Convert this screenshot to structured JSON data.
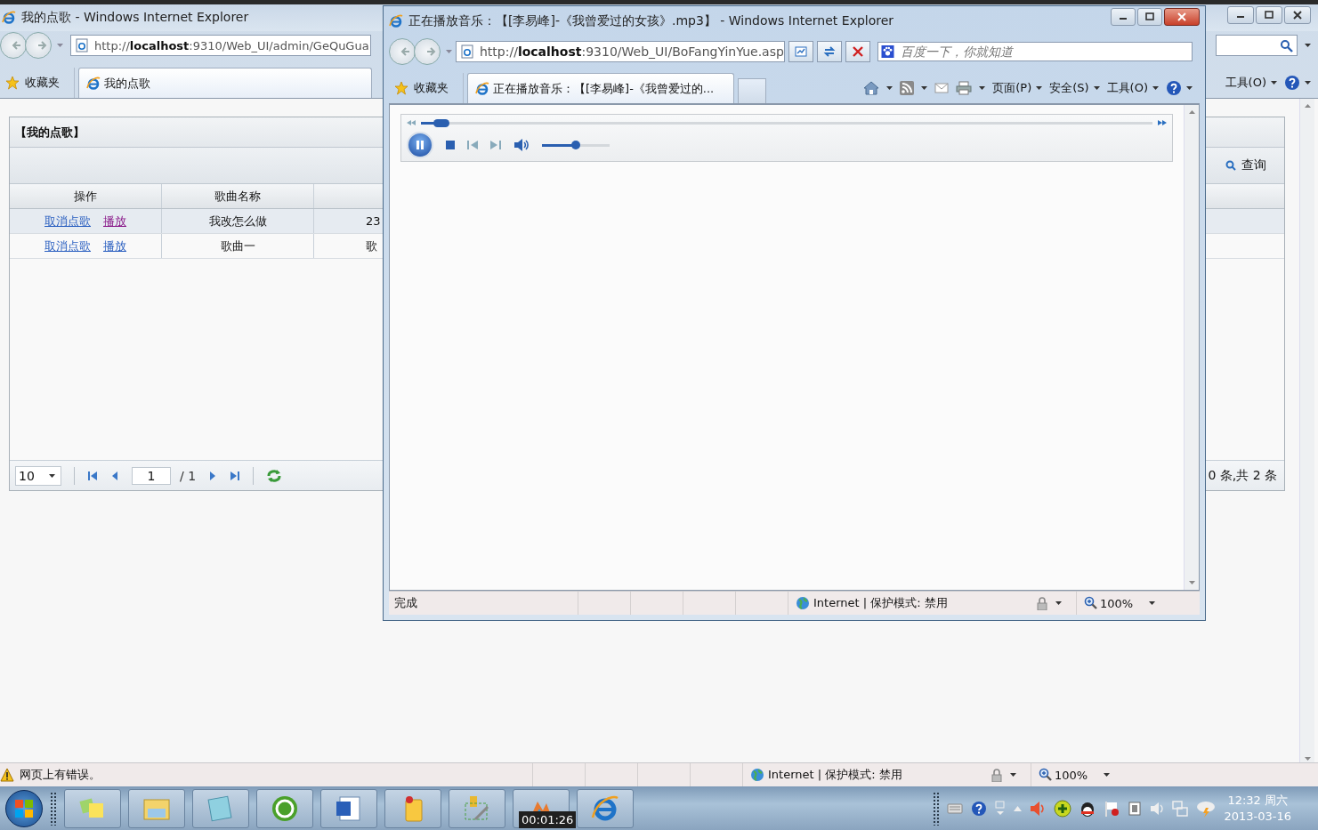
{
  "main_window": {
    "title": "我的点歌 - Windows Internet Explorer",
    "address": "http://localhost:9310/Web_UI/admin/GeQuGua",
    "favorites": "收藏夹",
    "tabs": [
      {
        "label": "我的点歌",
        "selected": true
      }
    ],
    "command_menus": [
      {
        "label": "工具(O)"
      }
    ],
    "panel": {
      "title": "【我的点歌】",
      "search_button": "查询",
      "action_column": "操作",
      "columns": [
        "歌曲名称"
      ],
      "rows": [
        {
          "links": [
            {
              "label": "取消点歌",
              "visited": false
            },
            {
              "label": "播放",
              "visited": true
            }
          ],
          "cells": [
            "我改怎么做",
            "23"
          ]
        },
        {
          "links": [
            {
              "label": "取消点歌",
              "visited": false
            },
            {
              "label": "播放",
              "visited": false
            }
          ],
          "cells": [
            "歌曲一",
            "歌"
          ]
        }
      ],
      "pager": {
        "page_size": "10",
        "page": "1",
        "total_pages": "/ 1",
        "summary": "0 条,共 2 条"
      }
    },
    "status_bar": {
      "message": "网页上有错误。",
      "zone": "Internet | 保护模式: 禁用",
      "zoom": "100%"
    }
  },
  "popup_window": {
    "title": "正在播放音乐：【[李易峰]-《我曾爱过的女孩》.mp3】 - Windows Internet Explorer",
    "address": "http://localhost:9310/Web_UI/BoFangYinYue.asp",
    "search": {
      "placeholder": "百度一下，你就知道"
    },
    "favorites": "收藏夹",
    "tabs": [
      {
        "label": "正在播放音乐：【[李易峰]-《我曾爱过的...",
        "selected": true
      }
    ],
    "command_menus": [
      {
        "label": "页面(P)"
      },
      {
        "label": "安全(S)"
      },
      {
        "label": "工具(O)"
      }
    ],
    "player": {
      "playing": true,
      "position": {
        "level": 0.02
      },
      "volume": {
        "level": 0.5
      }
    },
    "status_bar": {
      "message": "完成",
      "zone": "Internet | 保护模式: 禁用",
      "zoom": "100%"
    }
  },
  "taskbar": {
    "tooltip": "00:01:26",
    "clock": {
      "time": "12:32 周六",
      "date": "2013-03-16"
    }
  }
}
